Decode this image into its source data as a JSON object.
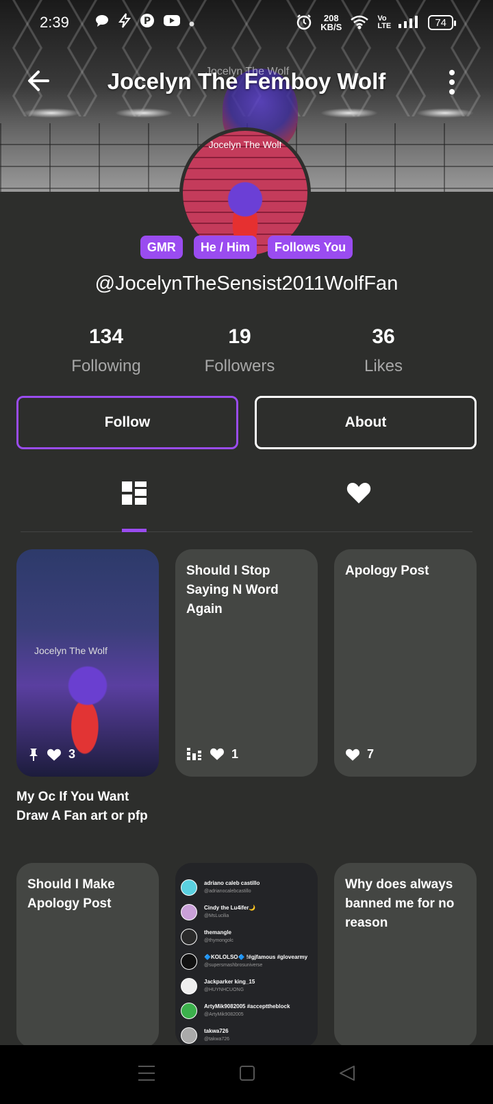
{
  "status_bar": {
    "time": "2:39",
    "speed_value": "208",
    "speed_unit": "KB/S",
    "network": "Vo LTE",
    "battery": "74"
  },
  "header": {
    "title": "Jocelyn The Femboy Wolf",
    "banner_text": "Jocelyn The Wolf"
  },
  "profile": {
    "avatar_label": "Jocelyn The Wolf",
    "badges": [
      "GMR",
      "He / Him",
      "Follows You"
    ],
    "username": "@JocelynTheSensist2011WolfFan",
    "stats": [
      {
        "value": "134",
        "label": "Following"
      },
      {
        "value": "19",
        "label": "Followers"
      },
      {
        "value": "36",
        "label": "Likes"
      }
    ]
  },
  "actions": {
    "follow": "Follow",
    "about": "About"
  },
  "posts": [
    {
      "title": "My Oc If You Want Draw A Fan art or pfp",
      "image_label": "Jocelyn The Wolf",
      "likes": "3",
      "pinned": true
    },
    {
      "title": "Should I Stop Saying N Word Again",
      "likes": "1"
    },
    {
      "title": "Apology Post",
      "likes": "7"
    },
    {
      "title": "Should I Make Apology Post"
    },
    {
      "list_preview": [
        {
          "name": "adriano caleb castillo",
          "handle": "@adrianocalebcastillo",
          "color": "#5ad0e0"
        },
        {
          "name": "Cindy the Lu4ifer🌙",
          "handle": "@MsLucilia",
          "color": "#c9a0d8"
        },
        {
          "name": "themangle",
          "handle": "@thymongolc",
          "color": "#2a2a2a"
        },
        {
          "name": "🔷KOLOLSO🔷 !#gjfamous #glovearmy",
          "handle": "@supersmashbrosuniverse",
          "color": "#111"
        },
        {
          "name": "Jackparker king_15",
          "handle": "@HUYNHCUONG",
          "color": "#eee"
        },
        {
          "name": "ArtyMik9082005 #accepttheblock",
          "handle": "@ArtyMik9082005",
          "color": "#3cb04c"
        },
        {
          "name": "takwa726",
          "handle": "@takwa726",
          "color": "#aaa"
        }
      ]
    },
    {
      "title": "Why does always banned me for no reason"
    }
  ],
  "colors": {
    "background": "#2d2e2c",
    "accent": "#9a4cf0",
    "card": "#444643"
  }
}
